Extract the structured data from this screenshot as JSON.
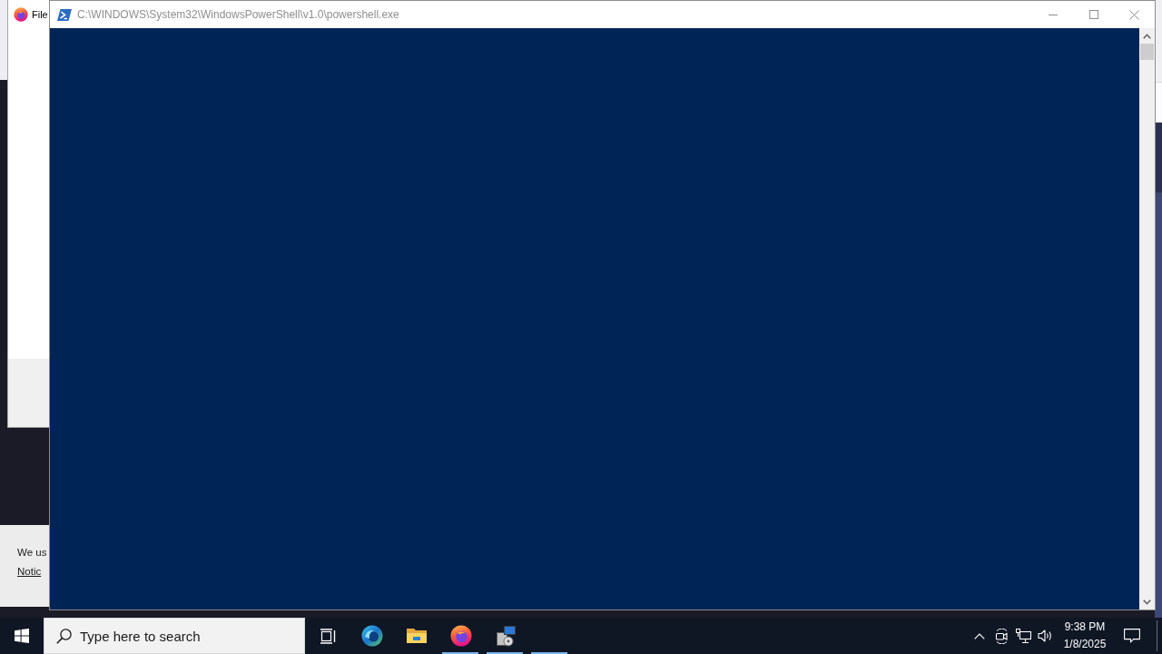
{
  "dialog_window": {
    "title": "File"
  },
  "terminal_window": {
    "title": "C:\\WINDOWS\\System32\\WindowsPowerShell\\v1.0\\powershell.exe"
  },
  "background_page": {
    "cookie_banner": {
      "text": "We us",
      "link": "Notic"
    }
  },
  "taskbar": {
    "search": {
      "placeholder": "Type here to search"
    },
    "apps": [
      {
        "kind": "swirl",
        "running": false
      },
      {
        "kind": "folder",
        "running": false
      },
      {
        "kind": "globe",
        "running": true
      },
      {
        "kind": "installer",
        "running": true
      },
      {
        "kind": "blank",
        "running": true
      }
    ],
    "clock": {
      "time": "9:38 PM",
      "date": "1/8/2025"
    }
  }
}
